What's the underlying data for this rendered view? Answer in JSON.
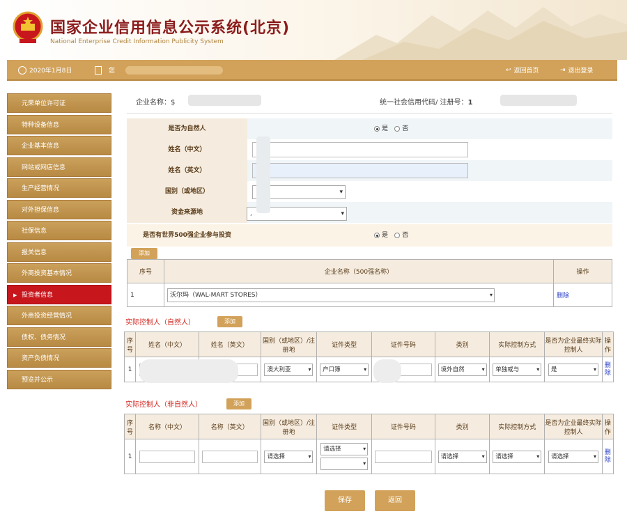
{
  "header": {
    "title": "国家企业信用信息公示系统(北京)",
    "subtitle": "National Enterprise Credit Information Publicity System"
  },
  "topbar": {
    "date": "2020年1月8日",
    "user_prefix": "您",
    "home": "返回首页",
    "logout": "退出登录"
  },
  "sidebar": {
    "items": [
      {
        "label": "元荣单位许可证"
      },
      {
        "label": "特种设备信息"
      },
      {
        "label": "企业基本信息"
      },
      {
        "label": "网站或网店信息"
      },
      {
        "label": "生产经营情况"
      },
      {
        "label": "对外担保信息"
      },
      {
        "label": "社保信息"
      },
      {
        "label": "报关信息"
      },
      {
        "label": "外商投资基本情况"
      },
      {
        "label": "投资者信息"
      },
      {
        "label": "外商投资经营情况"
      },
      {
        "label": "债权、债务情况"
      },
      {
        "label": "资产负债情况"
      },
      {
        "label": "预览并公示"
      }
    ]
  },
  "info": {
    "entname_label": "企业名称：",
    "entname_value": "$",
    "credit_label": "统一社会信用代码/ 注册号：",
    "credit_value": "1"
  },
  "form": {
    "natural_label": "是否为自然人",
    "yes": "是",
    "no": "否",
    "name_cn_label": "姓名（中文）",
    "name_en_label": "姓名（英文）",
    "country_label": "国别（或地区）",
    "fund_label": "资金来源地",
    "fund_value": ",",
    "fortune500_label": "是否有世界500强企业参与投资"
  },
  "add_label": "添加",
  "fortune_table": {
    "headers": [
      "序号",
      "企业名称（500强名称）",
      "操作"
    ],
    "row": {
      "no": "1",
      "company": "沃尔玛（WAL-MART STORES）",
      "action": "删除"
    }
  },
  "controller_natural": {
    "title": "实际控制人（自然人）",
    "headers": [
      "序号",
      "姓名（中文）",
      "姓名（英文）",
      "国别（或地区）/注册地",
      "证件类型",
      "证件号码",
      "类别",
      "实际控制方式",
      "是否为企业最终实际控制人",
      "操作"
    ],
    "row": {
      "no": "1",
      "country": "澳大利亚",
      "id_type": "户口簿",
      "category": "境外自然",
      "control": "单独或与",
      "final": "是",
      "action": "删除"
    }
  },
  "controller_non_natural": {
    "title": "实际控制人（非自然人）",
    "headers": [
      "序号",
      "名称（中文）",
      "名称（英文）",
      "国别（或地区）/注册地",
      "证件类型",
      "证件号码",
      "类别",
      "实际控制方式",
      "是否为企业最终实际控制人",
      "操作"
    ],
    "row": {
      "no": "1",
      "placeholder_select": "请选择",
      "action": "删除"
    }
  },
  "buttons": {
    "save": "保存",
    "back": "返回"
  }
}
